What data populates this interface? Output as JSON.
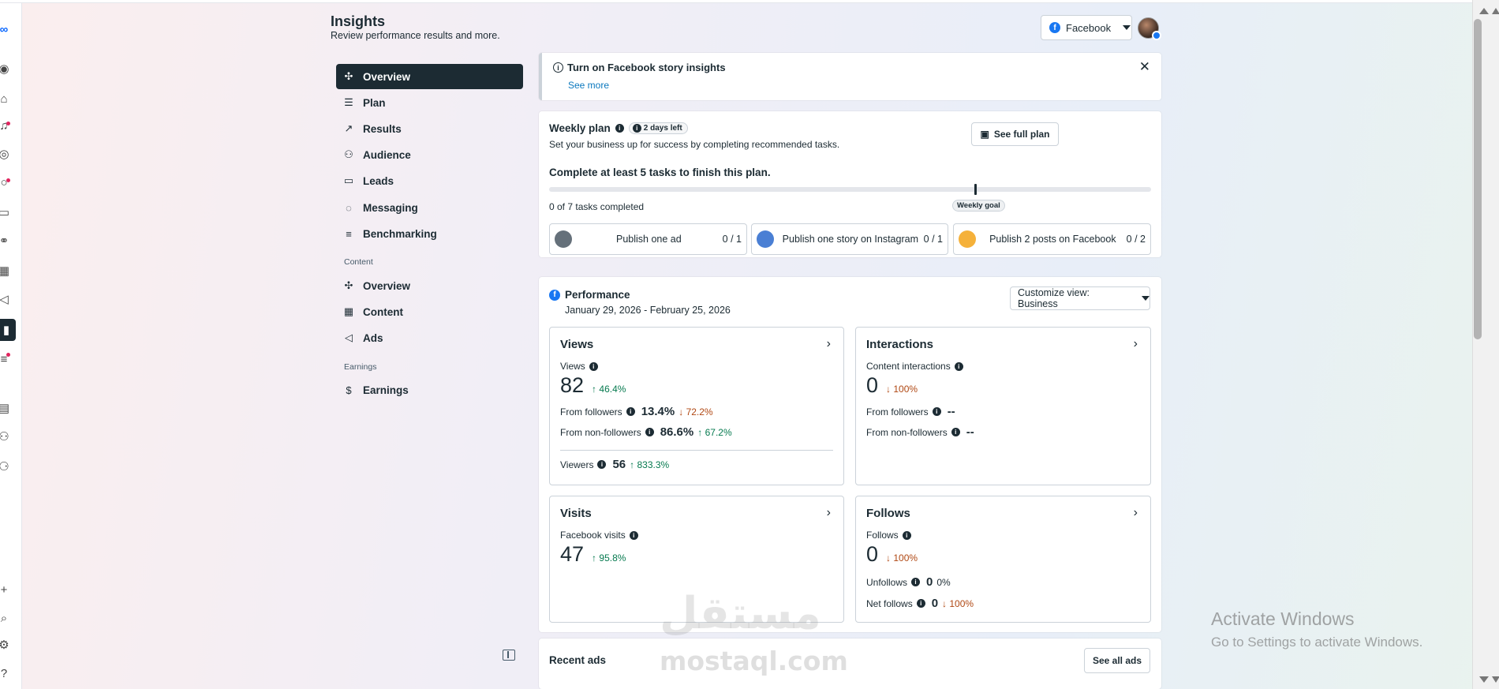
{
  "header": {
    "title": "Insights",
    "subtitle": "Review performance results and more.",
    "platform_label": "Facebook"
  },
  "nav": {
    "items": [
      {
        "label": "Overview"
      },
      {
        "label": "Plan"
      },
      {
        "label": "Results"
      },
      {
        "label": "Audience"
      },
      {
        "label": "Leads"
      },
      {
        "label": "Messaging"
      },
      {
        "label": "Benchmarking"
      }
    ],
    "content_section": "Content",
    "content_items": [
      {
        "label": "Overview"
      },
      {
        "label": "Content"
      },
      {
        "label": "Ads"
      }
    ],
    "earnings_section": "Earnings",
    "earnings_items": [
      {
        "label": "Earnings"
      }
    ]
  },
  "notice": {
    "title": "Turn on Facebook story insights",
    "link": "See more"
  },
  "weekly_plan": {
    "title": "Weekly plan",
    "badge": "2 days left",
    "subtitle": "Set your business up for success by completing recommended tasks.",
    "see_full_plan": "See full plan",
    "goal_text": "Complete at least 5 tasks to finish this plan.",
    "tasks_completed": "0 of 7 tasks completed",
    "progress_fraction": 0,
    "weekly_goal_label": "Weekly goal",
    "tasks": [
      {
        "label": "Publish one ad",
        "value": "0 / 1"
      },
      {
        "label": "Publish one story on Instagram",
        "value": "0 / 1"
      },
      {
        "label": "Publish 2 posts on Facebook",
        "value": "0 / 2"
      }
    ]
  },
  "performance": {
    "title": "Performance",
    "date_range": "January 29, 2026 - February 25, 2026",
    "customize_view": "Customize view: Business",
    "views": {
      "title": "Views",
      "metric_label": "Views",
      "value": "82",
      "change": "46.4%",
      "from_followers_label": "From followers",
      "from_followers_value": "13.4%",
      "from_followers_change": "72.2%",
      "from_non_followers_label": "From non-followers",
      "from_non_followers_value": "86.6%",
      "from_non_followers_change": "67.2%",
      "viewers_label": "Viewers",
      "viewers_value": "56",
      "viewers_change": "833.3%"
    },
    "interactions": {
      "title": "Interactions",
      "metric_label": "Content interactions",
      "value": "0",
      "change": "100%",
      "from_followers_label": "From followers",
      "from_followers_value": "--",
      "from_non_followers_label": "From non-followers",
      "from_non_followers_value": "--"
    },
    "visits": {
      "title": "Visits",
      "metric_label": "Facebook visits",
      "value": "47",
      "change": "95.8%"
    },
    "follows": {
      "title": "Follows",
      "metric_label": "Follows",
      "value": "0",
      "change": "100%",
      "unfollows_label": "Unfollows",
      "unfollows_value": "0",
      "unfollows_change": "0%",
      "net_follows_label": "Net follows",
      "net_follows_value": "0",
      "net_follows_change": "100%"
    }
  },
  "recent_ads": {
    "title": "Recent ads",
    "see_all": "See all ads"
  },
  "watermark": {
    "arabic": "مستقل",
    "latin": "mostaql.com"
  },
  "activate_windows": {
    "line1": "Activate Windows",
    "line2": "Go to Settings to activate Windows."
  },
  "colors": {
    "accent_dark": "#1c2b33",
    "link_blue": "#0a78be",
    "positive": "#067a4f",
    "negative": "#b04813",
    "facebook_blue": "#1877f2"
  }
}
